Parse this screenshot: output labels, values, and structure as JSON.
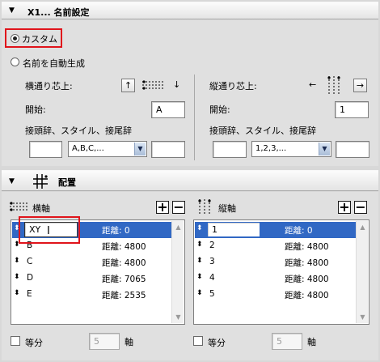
{
  "name_section": {
    "title": "X1... 名前設定",
    "radio_custom": "カスタム",
    "radio_auto": "名前を自動生成",
    "horizontal": {
      "title": "横通り芯上:",
      "start_label": "開始:",
      "start_value": "A",
      "affix_label": "接頭辞、スタイル、接尾辞",
      "prefix": "",
      "style": "A,B,C,...",
      "suffix": "",
      "up_glyph": "↑",
      "down_glyph": "↓"
    },
    "vertical": {
      "title": "縦通り芯上:",
      "start_label": "開始:",
      "start_value": "1",
      "affix_label": "接頭辞、スタイル、接尾辞",
      "prefix": "",
      "style": "1,2,3,...",
      "suffix": "",
      "left_glyph": "←",
      "right_glyph": "→"
    }
  },
  "layout_section": {
    "title": "配置",
    "horizontal_axis": {
      "label": "横軸",
      "add": "+",
      "remove": "−",
      "rows": [
        {
          "name": "XY",
          "distance": "距離: 0"
        },
        {
          "name": "B",
          "distance": "距離: 4800"
        },
        {
          "name": "C",
          "distance": "距離: 4800"
        },
        {
          "name": "D",
          "distance": "距離: 7065"
        },
        {
          "name": "E",
          "distance": "距離: 2535"
        }
      ],
      "equal_label": "等分",
      "count": "5",
      "axis_unit": "軸"
    },
    "vertical_axis": {
      "label": "縦軸",
      "add": "+",
      "remove": "−",
      "rows": [
        {
          "name": "1",
          "distance": "距離: 0"
        },
        {
          "name": "2",
          "distance": "距離: 4800"
        },
        {
          "name": "3",
          "distance": "距離: 4800"
        },
        {
          "name": "4",
          "distance": "距離: 4800"
        },
        {
          "name": "5",
          "distance": "距離: 4800"
        }
      ],
      "equal_label": "等分",
      "count": "5",
      "axis_unit": "軸"
    }
  },
  "colors": {
    "highlight": "#e0141b",
    "selection": "#3168c4"
  }
}
